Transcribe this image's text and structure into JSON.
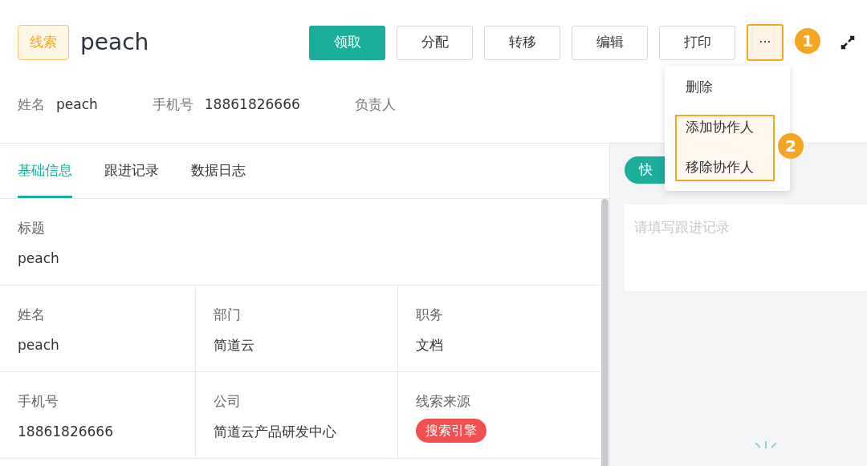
{
  "header": {
    "tag": "线索",
    "title": "peach",
    "buttons": [
      {
        "label": "领取",
        "kind": "primary"
      },
      {
        "label": "分配",
        "kind": "default"
      },
      {
        "label": "转移",
        "kind": "default"
      },
      {
        "label": "编辑",
        "kind": "default"
      },
      {
        "label": "打印",
        "kind": "default"
      }
    ],
    "more_button": {
      "label": "···",
      "highlighted": true
    }
  },
  "summary": [
    {
      "label": "姓名",
      "value": "peach"
    },
    {
      "label": "手机号",
      "value": "18861826666"
    },
    {
      "label": "负责人"
    }
  ],
  "tabs": [
    {
      "label": "基础信息",
      "selected": true
    },
    {
      "label": "跟进记录",
      "selected": false
    },
    {
      "label": "数据日志",
      "selected": false
    }
  ],
  "fields": [
    [
      {
        "label": "标题",
        "value": "peach"
      }
    ],
    [
      {
        "label": "姓名",
        "value": "peach"
      },
      {
        "label": "部门",
        "value": "简道云"
      },
      {
        "label": "职务",
        "value": "文档"
      }
    ],
    [
      {
        "label": "手机号",
        "value": "18861826666"
      },
      {
        "label": "公司",
        "value": "简道云产品研发中心"
      },
      {
        "label": "线索来源",
        "tag": "搜索引擎",
        "color": "#f0504f"
      }
    ]
  ],
  "side": {
    "chip": "快",
    "placeholder": "请填写跟进记录"
  },
  "dropdown": [
    {
      "label": "删除",
      "highlighted": false
    },
    {
      "label": "添加协作人",
      "highlighted": true
    },
    {
      "label": "移除协作人",
      "highlighted": true
    }
  ],
  "annotations": [
    "1",
    "2"
  ]
}
